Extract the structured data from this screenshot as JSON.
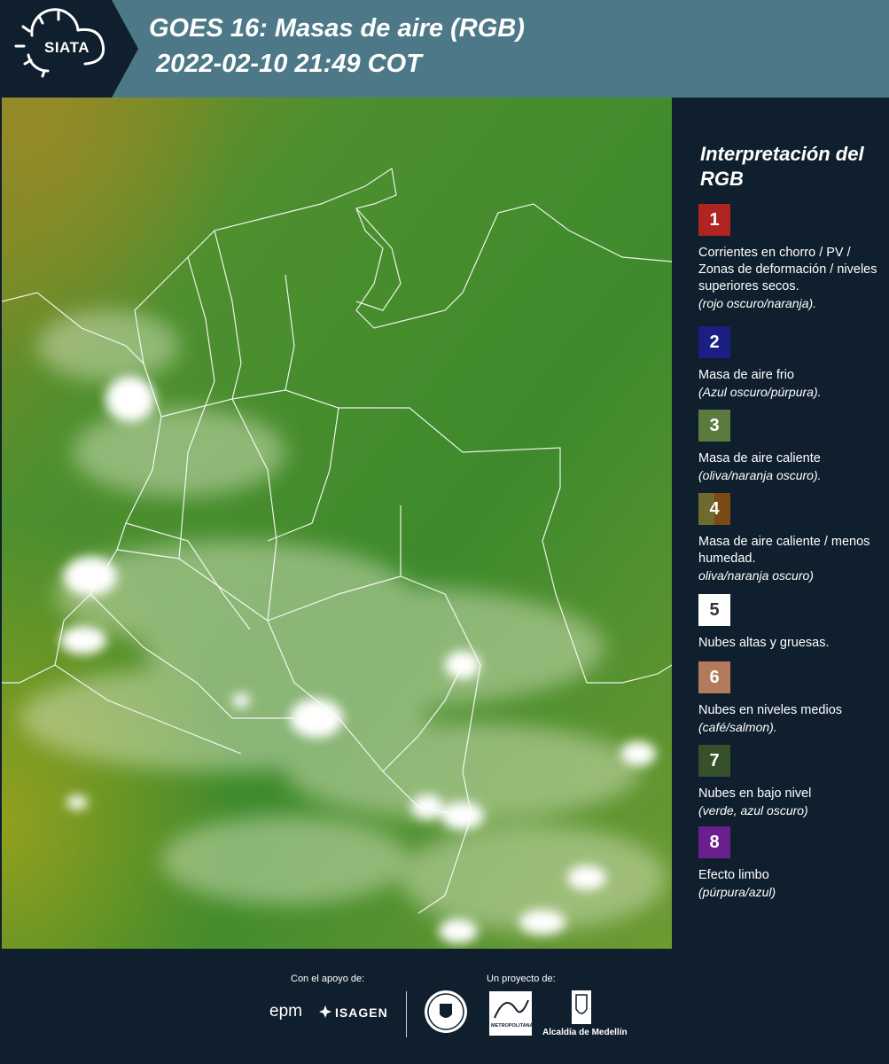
{
  "header": {
    "logo": "SIATA",
    "title_line1": "GOES 16: Masas de aire (RGB)",
    "title_line2": "2022-02-10 21:49 COT"
  },
  "legend": {
    "title": "Interpretación del RGB",
    "items": [
      {
        "num": "1",
        "color": "#b02421",
        "desc": "Corrientes en chorro / PV / Zonas de deformación / niveles superiores secos.",
        "note": "(rojo oscuro/naranja)."
      },
      {
        "num": "2",
        "color": "#1b1f83",
        "desc": "Masa de aire frio",
        "note": "(Azul oscuro/púrpura)."
      },
      {
        "num": "3",
        "color": "#5b7b3e",
        "desc": "Masa de aire caliente",
        "note": "(oliva/naranja oscuro)."
      },
      {
        "num": "4",
        "color": "#7a5c2a",
        "desc": "Masa de aire caliente / menos humedad.",
        "note": "oliva/naranja oscuro)"
      },
      {
        "num": "5",
        "color": "#ffffff",
        "desc": "Nubes altas y gruesas.",
        "note": ""
      },
      {
        "num": "6",
        "color": "#b47a5c",
        "desc": "Nubes en niveles medios",
        "note": "(café/salmon)."
      },
      {
        "num": "7",
        "color": "#35502a",
        "desc": "Nubes en bajo nivel",
        "note": "(verde, azul oscuro)"
      },
      {
        "num": "8",
        "color": "#6a1f8c",
        "desc": "Efecto limbo",
        "note": "(púrpura/azul)"
      }
    ]
  },
  "footer": {
    "support_label": "Con el apoyo de:",
    "project_label": "Un proyecto de:",
    "sponsor1": "epm",
    "sponsor2": "ISAGEN",
    "partner1": "METROPOLITANA",
    "partner2": "Alcaldía de Medellín"
  },
  "colors": {
    "header_bg": "#4d7888",
    "panel_bg": "#0f1f2d",
    "map_green": "#3f8a2c",
    "map_olive": "#8c9a1e"
  }
}
